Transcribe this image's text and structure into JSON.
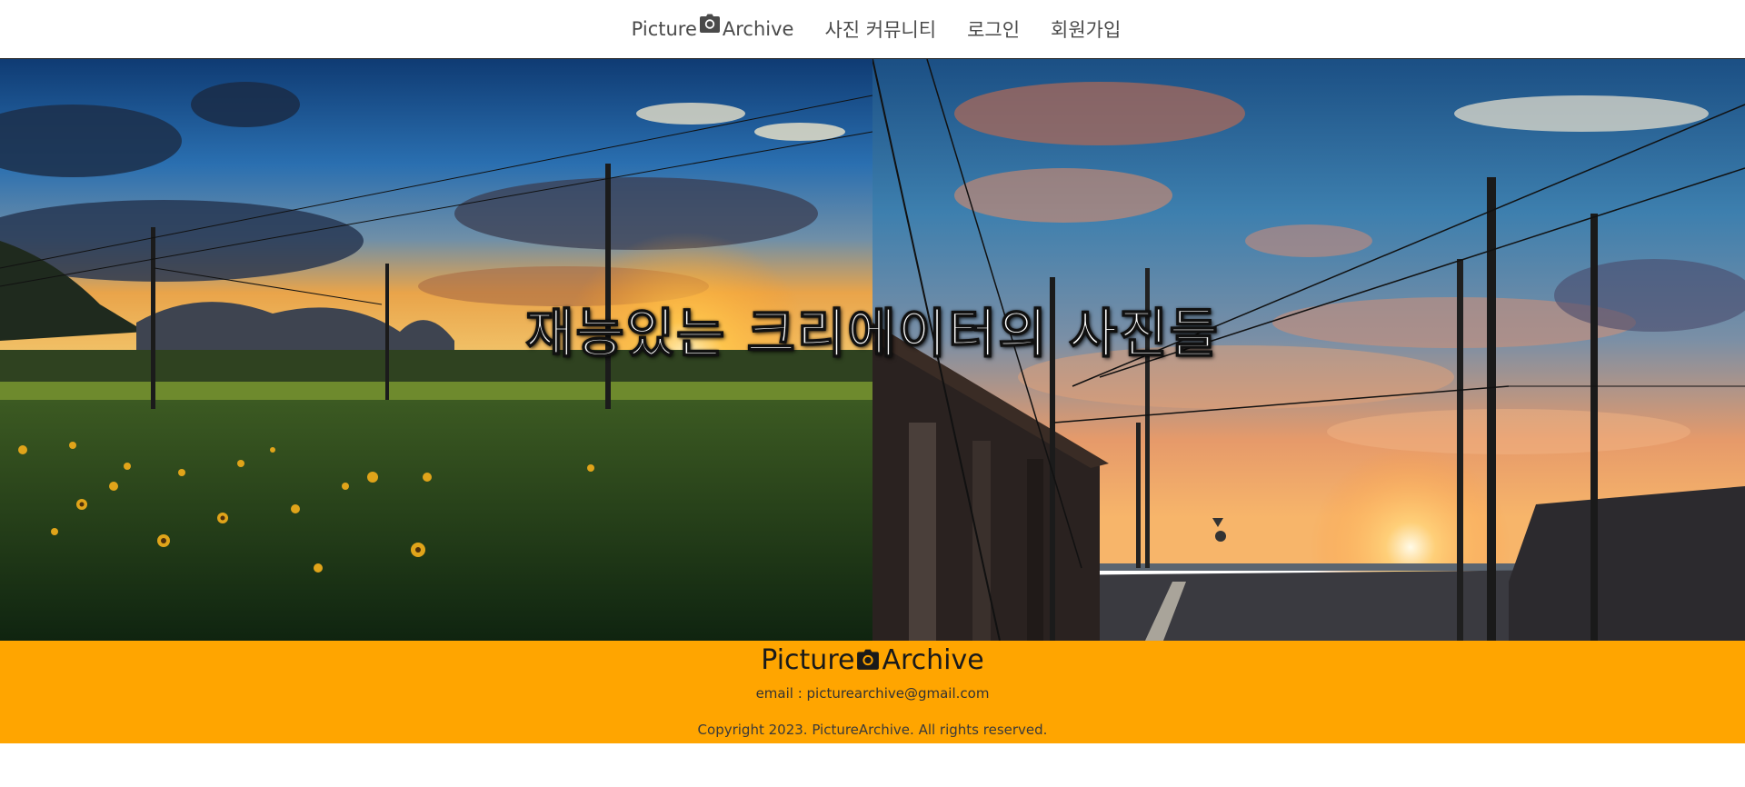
{
  "nav": {
    "brand_left": "Picture",
    "brand_icon": "camera-icon",
    "brand_right": "Archive",
    "links": [
      "사진 커뮤니티",
      "로그인",
      "회원가입"
    ]
  },
  "hero": {
    "title": "재능있는 크리에이터의 사진들"
  },
  "footer": {
    "brand_left": "Picture",
    "brand_icon": "camera-icon",
    "brand_right": "Archive",
    "email": "email : picturearchive@gmail.com",
    "copyright": "Copyright 2023. PictureArchive. All rights reserved."
  },
  "colors": {
    "footer_bg": "#ffa500",
    "nav_text": "#4a4a4a"
  }
}
